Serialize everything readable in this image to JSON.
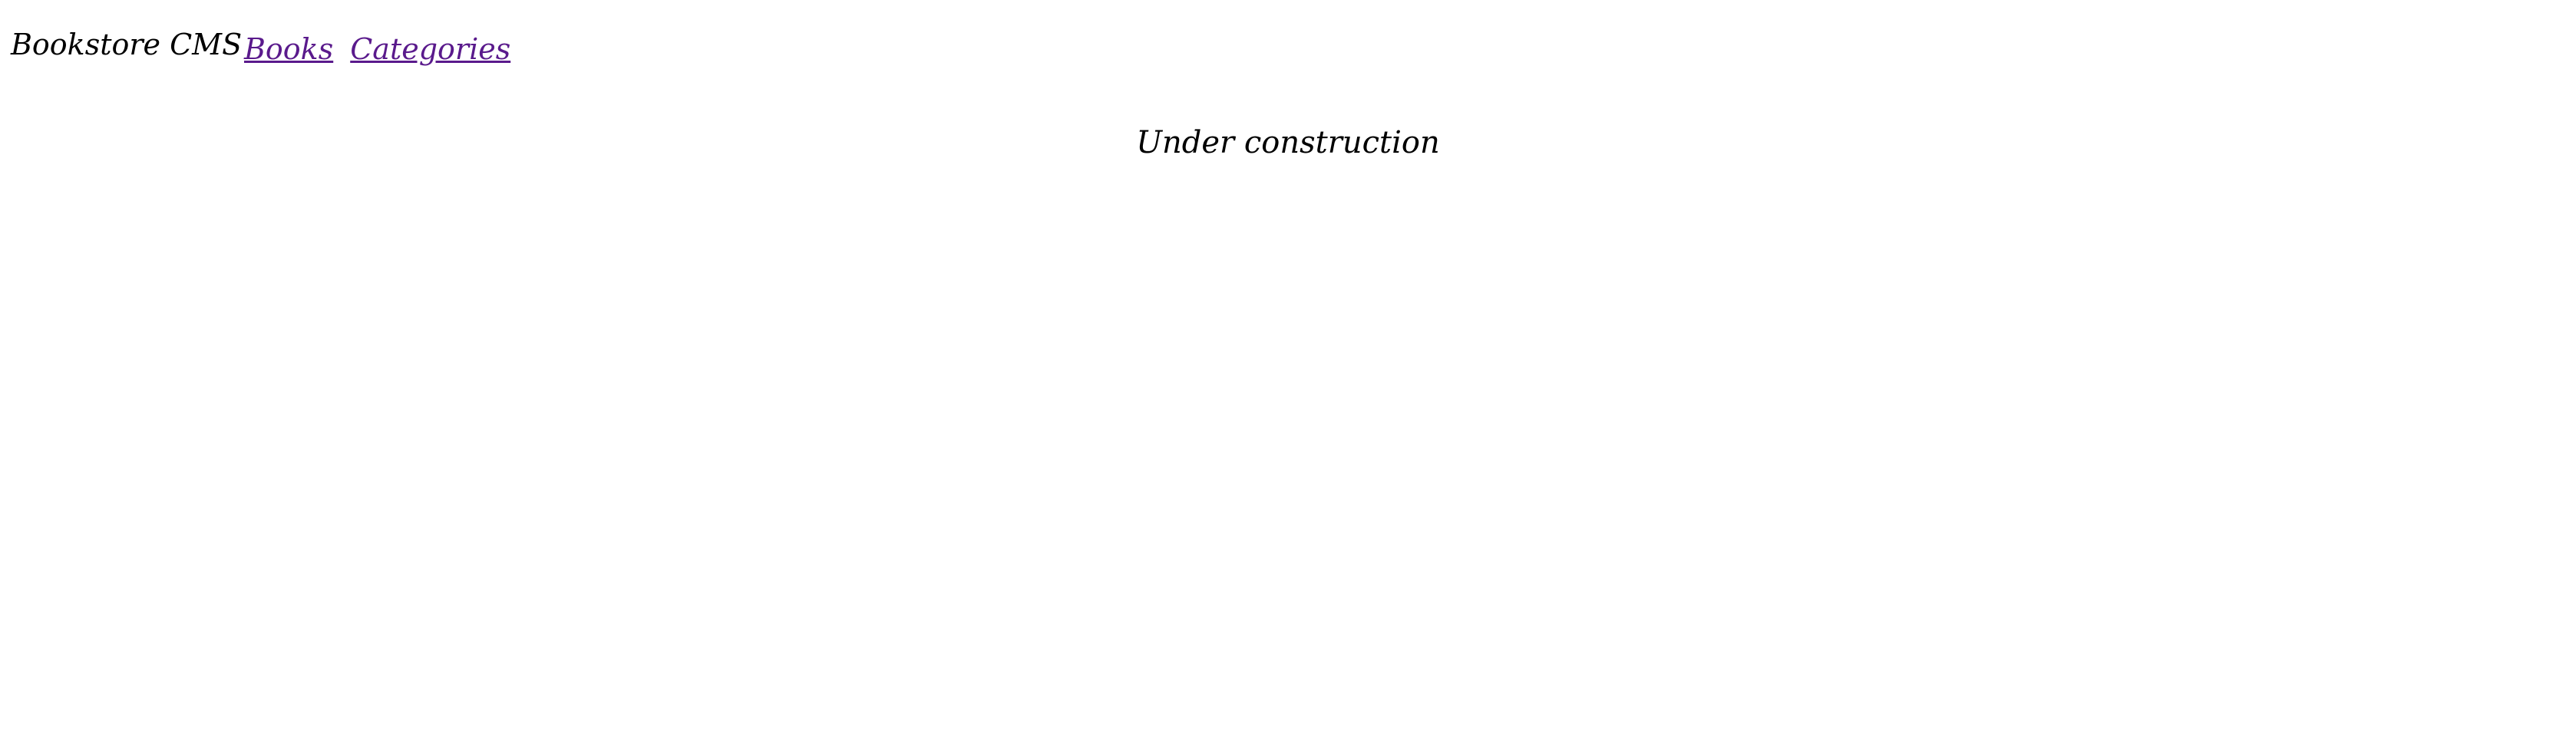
{
  "header": {
    "brand": "Bookstore CMS",
    "nav": {
      "items": [
        {
          "label": "Books"
        },
        {
          "label": "Categories"
        }
      ]
    },
    "link_color": "#5a1a8c"
  },
  "main": {
    "message": "Under construction"
  }
}
